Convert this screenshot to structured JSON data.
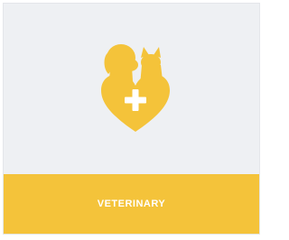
{
  "card": {
    "title": "VETERINARY",
    "icon": "pet-heart-plus-icon"
  },
  "colors": {
    "card_background": "#eef0f3",
    "accent": "#f4c33a",
    "label_text": "#ffffff"
  }
}
